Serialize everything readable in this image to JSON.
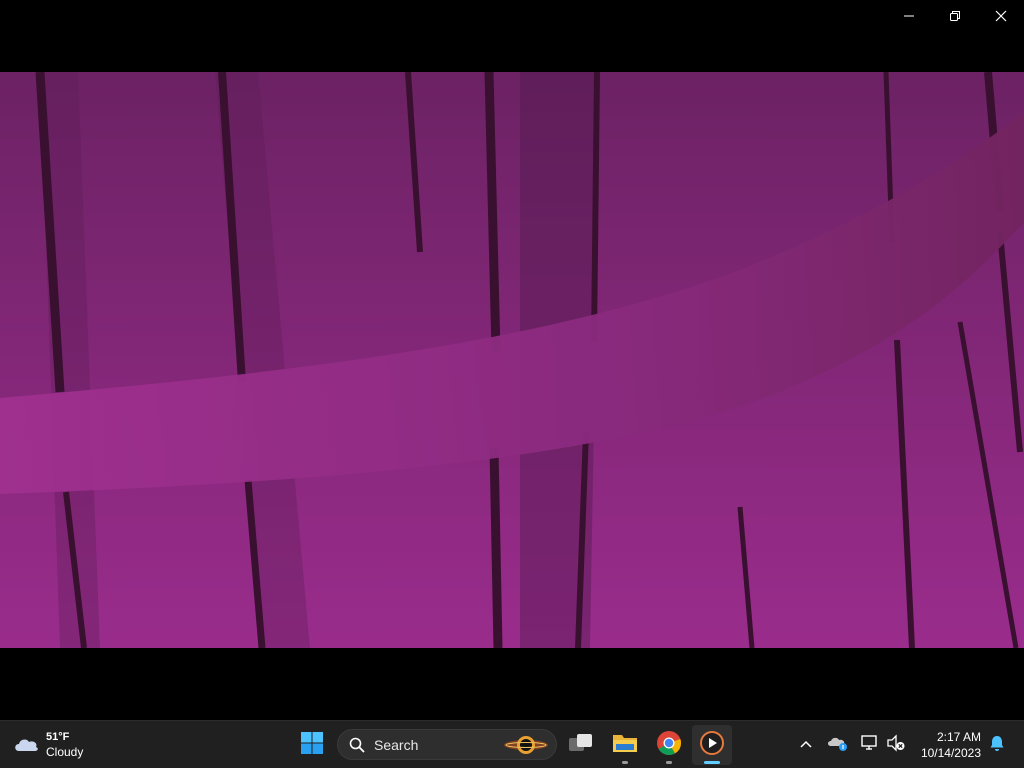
{
  "window": {
    "controls": {
      "minimize": "minimize",
      "restore": "restore",
      "close": "close"
    }
  },
  "video": {
    "background_color": "#7a2672",
    "band_color": "#9a2e8c",
    "stroke_color": "#3a1030"
  },
  "taskbar": {
    "weather": {
      "icon": "cloud-icon",
      "temperature": "51°F",
      "condition": "Cloudy"
    },
    "start": {
      "icon": "windows-logo-icon"
    },
    "search": {
      "icon": "search-icon",
      "label": "Search"
    },
    "apps": [
      {
        "name": "Task View",
        "icon": "task-view-icon",
        "running": false,
        "active": false
      },
      {
        "name": "File Explorer",
        "icon": "folder-icon",
        "running": true,
        "active": false
      },
      {
        "name": "Google Chrome",
        "icon": "chrome-icon",
        "running": true,
        "active": false
      },
      {
        "name": "Media Player",
        "icon": "media-player-icon",
        "running": true,
        "active": true
      }
    ],
    "tray": {
      "overflow_icon": "chevron-up-icon",
      "onedrive_icon": "onedrive-icon",
      "network_icon": "network-icon",
      "volume_icon": "volume-muted-icon",
      "notification_icon": "bell-icon"
    },
    "clock": {
      "time": "2:17 AM",
      "date": "10/14/2023"
    },
    "accent_color": "#60cdff"
  }
}
